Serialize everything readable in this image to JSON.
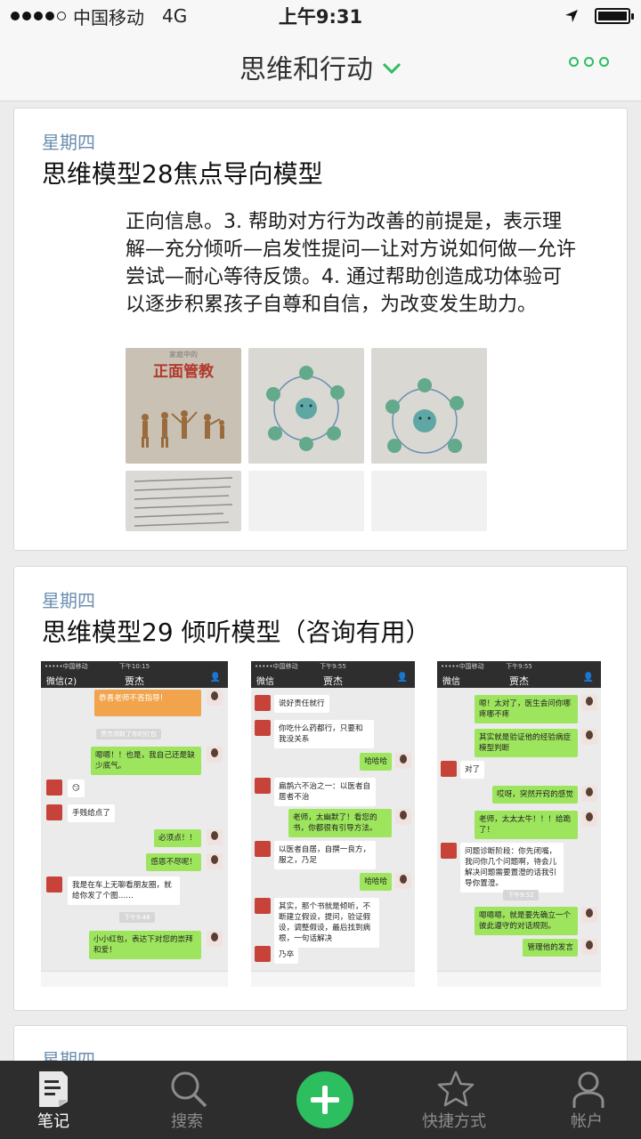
{
  "status_bar": {
    "carrier": "中国移动",
    "network": "4G",
    "time": "上午9:31",
    "signal_bars": 4,
    "signal_max": 5,
    "battery_level": 1.0
  },
  "header": {
    "title": "思维和行动",
    "dropdown_icon": "chevron-down-icon",
    "more_icon": "more-dots-icon",
    "accent_color": "#2dbe60"
  },
  "notes": [
    {
      "date": "星期四",
      "title": "思维模型28焦点导向模型",
      "excerpt": "正向信息。3. 帮助对方行为改善的前提是，表示理解—充分倾听—启发性提问—让对方说如何做—允许尝试—耐心等待反馈。4. 通过帮助创造成功体验可以逐步积累孩子自尊和自信，为改变发生助力。",
      "images": {
        "book_small_text": "家庭中的",
        "book_title": "正面管教"
      }
    },
    {
      "date": "星期四",
      "title": "思维模型29 倾听模型（咨询有用）",
      "chats": [
        {
          "contact": "贾杰",
          "back_label": "微信(2)",
          "messages": [
            {
              "side": "o",
              "text": "恭喜老师不吝指导!"
            },
            {
              "side": "t",
              "text": "贾杰领取了你的红包"
            },
            {
              "side": "r",
              "text": "嗯嗯！！也是，我自己还是缺少底气。"
            },
            {
              "side": "l",
              "text": "😏"
            },
            {
              "side": "l",
              "text": "手贱给点了"
            },
            {
              "side": "r",
              "text": "必须点！！"
            },
            {
              "side": "r",
              "text": "感恩不尽呢！"
            },
            {
              "side": "l",
              "text": "我是在车上无聊看朋友圈，就给你发了个图……"
            },
            {
              "side": "t",
              "text": "下午9:48"
            },
            {
              "side": "r",
              "text": "小小红包，表达下对您的崇拜和爱！"
            }
          ]
        },
        {
          "contact": "贾杰",
          "back_label": "微信",
          "messages": [
            {
              "side": "l",
              "text": "说好责任就行"
            },
            {
              "side": "l",
              "text": "你吃什么药都行，只要和我没关系"
            },
            {
              "side": "r",
              "text": "哈哈哈"
            },
            {
              "side": "l",
              "text": "扁鹊六不治之一：以医者自居者不治"
            },
            {
              "side": "r",
              "text": "老师，太幽默了！看您的书，你都很有引导方法。"
            },
            {
              "side": "l",
              "text": "以医者自居，自撰一良方，服之，乃足"
            },
            {
              "side": "r",
              "text": "哈哈哈"
            },
            {
              "side": "l",
              "text": "其实，那个书就是倾听，不断建立假设，提问，验证假设，调整假设，最后找到病根，一句话解决"
            },
            {
              "side": "l",
              "text": "乃卒"
            }
          ]
        },
        {
          "contact": "贾杰",
          "back_label": "微信",
          "messages": [
            {
              "side": "r",
              "text": "嗯！太对了，医生会问你哪疼哪不疼"
            },
            {
              "side": "r",
              "text": "其实就是验证他的经验病症模型判断"
            },
            {
              "side": "l",
              "text": "对了"
            },
            {
              "side": "r",
              "text": "哎呀，突然开窍的感觉"
            },
            {
              "side": "r",
              "text": "老师，太太太牛！！！给跪了！"
            },
            {
              "side": "l",
              "text": "问题诊断阶段：你先闭嘴，我问你几个问题啊，待会儿解决问题需要置澄的话我引导你置澄。"
            },
            {
              "side": "t",
              "text": "下午9:52"
            },
            {
              "side": "r",
              "text": "嗯嗯嗯，就是要先确立一个彼此遵守的对话规则。"
            },
            {
              "side": "r",
              "text": "管理他的发言"
            }
          ]
        }
      ]
    },
    {
      "date": "星期四",
      "title": ""
    }
  ],
  "tab_bar": {
    "tabs": [
      {
        "label": "笔记",
        "icon": "note-icon",
        "active": true
      },
      {
        "label": "搜索",
        "icon": "search-icon",
        "active": false
      },
      {
        "label": "快捷方式",
        "icon": "star-icon",
        "active": false
      },
      {
        "label": "帐户",
        "icon": "user-icon",
        "active": false
      }
    ],
    "add_icon": "plus-icon"
  }
}
